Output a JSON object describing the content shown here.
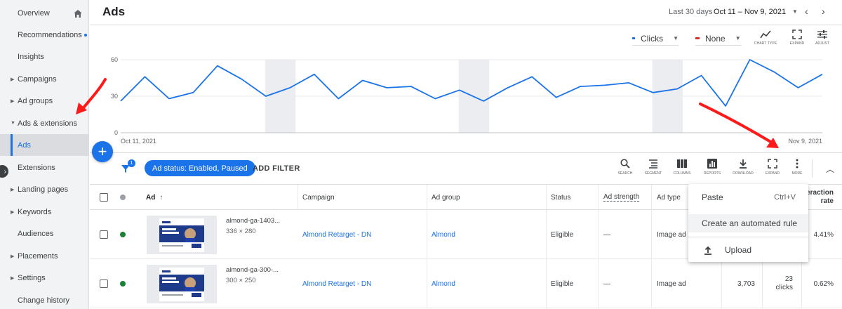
{
  "sidebar": {
    "items": [
      {
        "label": "Overview",
        "caret": false
      },
      {
        "label": "Recommendations",
        "caret": false
      },
      {
        "label": "Insights",
        "caret": false
      },
      {
        "label": "Campaigns",
        "caret": true
      },
      {
        "label": "Ad groups",
        "caret": true
      },
      {
        "label": "Ads & extensions",
        "caret": true
      },
      {
        "label": "Ads",
        "caret": false
      },
      {
        "label": "Extensions",
        "caret": false
      },
      {
        "label": "Landing pages",
        "caret": true
      },
      {
        "label": "Keywords",
        "caret": true
      },
      {
        "label": "Audiences",
        "caret": false
      },
      {
        "label": "Placements",
        "caret": true
      },
      {
        "label": "Settings",
        "caret": true
      },
      {
        "label": "Change history",
        "caret": false
      }
    ]
  },
  "header": {
    "title": "Ads",
    "date_range_label": "Last 30 days",
    "date_range": "Oct 11 – Nov 9, 2021"
  },
  "chart_controls": {
    "metric1": "Clicks",
    "metric1_color": "#1a73e8",
    "metric2": "None",
    "metric2_color": "#d93025",
    "tools": [
      "CHART TYPE",
      "EXPAND",
      "ADJUST"
    ]
  },
  "chart_data": {
    "type": "line",
    "x_start_label": "Oct 11, 2021",
    "x_end_label": "Nov 9, 2021",
    "y_ticks": [
      "60",
      "30",
      "0"
    ],
    "ylim": [
      0,
      60
    ],
    "series": [
      {
        "values": [
          26,
          46,
          28,
          33,
          55,
          44,
          30,
          37,
          48,
          28,
          43,
          37,
          38,
          28,
          35,
          26,
          37,
          46,
          29,
          38,
          39,
          41,
          33,
          36,
          47,
          22,
          60,
          50,
          37,
          48
        ]
      }
    ]
  },
  "filter_bar": {
    "filter_count": "1",
    "chip": "Ad status: Enabled, Paused",
    "add_filter": "ADD FILTER",
    "tools": [
      "SEARCH",
      "SEGMENT",
      "COLUMNS",
      "REPORTS",
      "DOWNLOAD",
      "EXPAND",
      "MORE"
    ]
  },
  "table": {
    "headers": {
      "ad": "Ad",
      "campaign": "Campaign",
      "ad_group": "Ad group",
      "status": "Status",
      "ad_strength": "Ad strength",
      "ad_type": "Ad type",
      "interaction_line1": "teraction",
      "interaction_line2": "rate"
    },
    "rows": [
      {
        "name": "almond-ga-1403...",
        "size": "336 × 280",
        "campaign": "Almond Retarget - DN",
        "ad_group": "Almond",
        "status": "Eligible",
        "ad_strength": "—",
        "ad_type": "Image ad",
        "impressions": "",
        "clicks": "",
        "clicks_label": "",
        "interaction_rate": "4.41%"
      },
      {
        "name": "almond-ga-300-...",
        "size": "300 × 250",
        "campaign": "Almond Retarget - DN",
        "ad_group": "Almond",
        "status": "Eligible",
        "ad_strength": "—",
        "ad_type": "Image ad",
        "impressions": "3,703",
        "clicks": "23",
        "clicks_label": "clicks",
        "interaction_rate": "0.62%"
      }
    ]
  },
  "menu": {
    "paste": "Paste",
    "paste_shortcut": "Ctrl+V",
    "automated_rule": "Create an automated rule",
    "upload": "Upload"
  }
}
